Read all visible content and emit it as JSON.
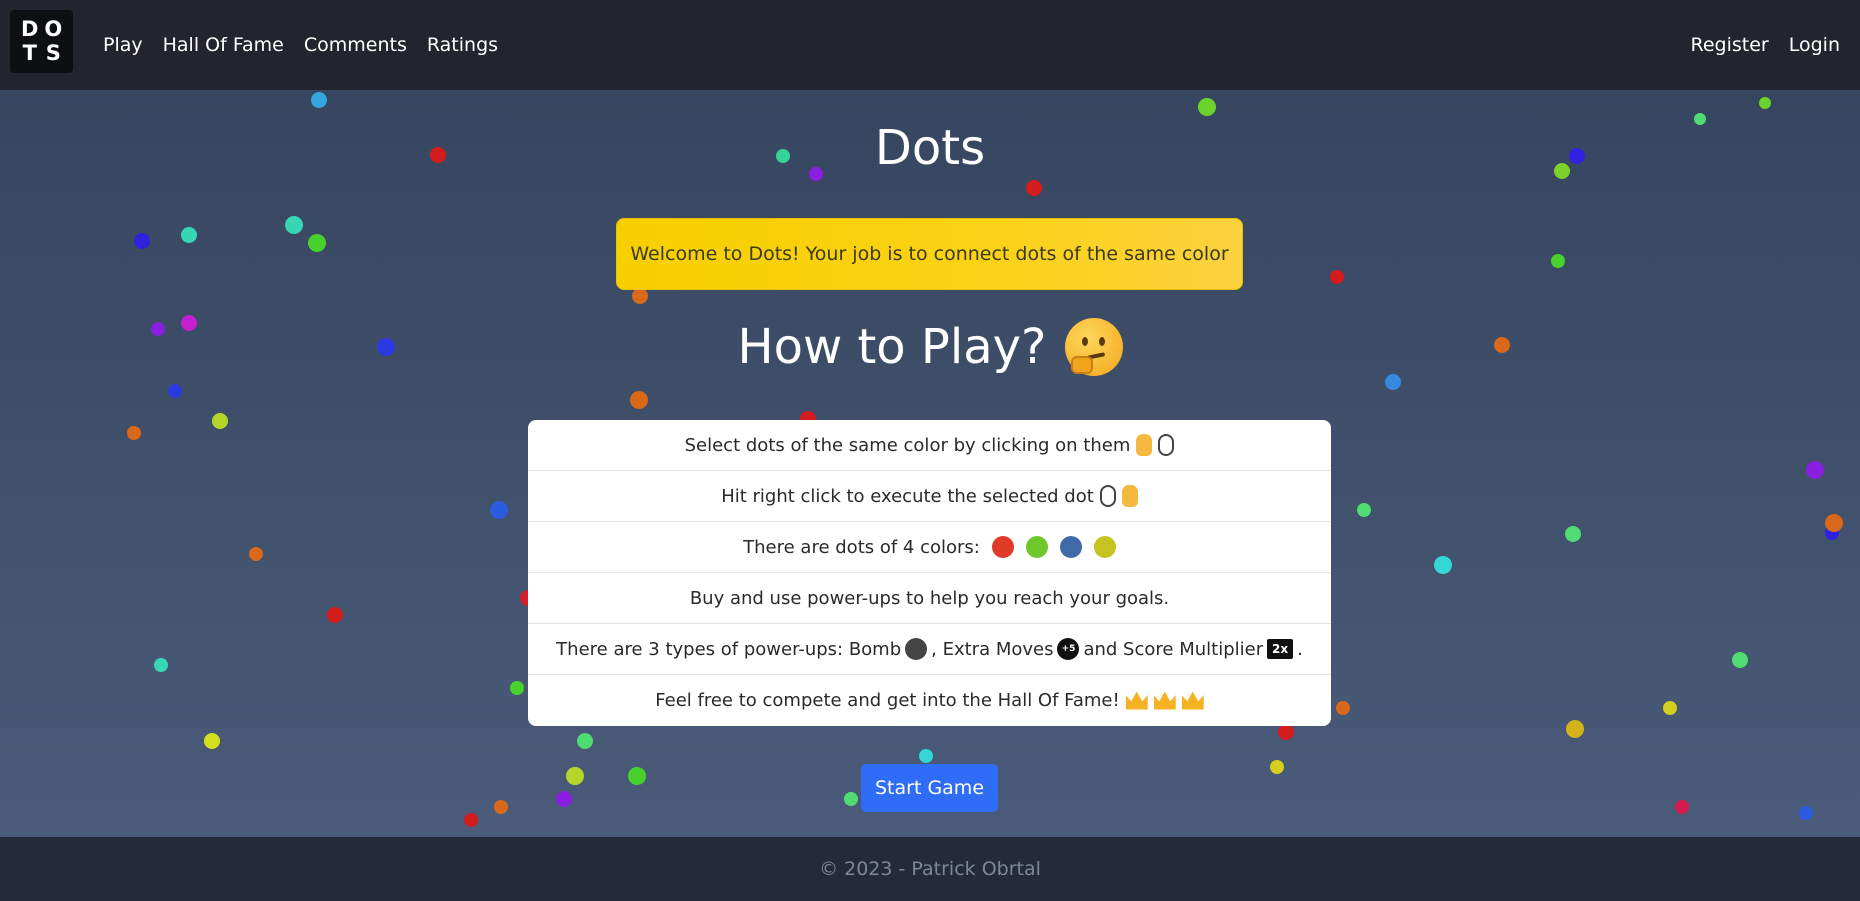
{
  "navbar": {
    "logo_letters": [
      "D",
      "O",
      "T",
      "S"
    ],
    "left_links": [
      "Play",
      "Hall Of Fame",
      "Comments",
      "Ratings"
    ],
    "right_links": [
      "Register",
      "Login"
    ]
  },
  "main": {
    "title": "Dots",
    "alert_text": "Welcome to Dots! Your job is to connect dots of the same color",
    "how_to_play_title": "How to Play?",
    "rules": [
      "Select dots of the same color by clicking on them",
      "Hit right click to execute the selected dot",
      "There are dots of 4 colors:",
      "Buy and use power-ups to help you reach your goals.",
      "There are 3 types of power-ups: Bomb",
      ", Extra Moves",
      "and Score Multiplier",
      ".",
      "Feel free to compete and get into the Hall Of Fame!"
    ],
    "dot_colors": [
      "#e23a2a",
      "#6ec82b",
      "#3f6aa7",
      "#c6c21f"
    ],
    "power_up_icons": {
      "extra_moves": "+5",
      "multiplier": "2x"
    },
    "start_button": "Start Game"
  },
  "footer": {
    "copyright": "© 2023 - Patrick Obrtal"
  }
}
